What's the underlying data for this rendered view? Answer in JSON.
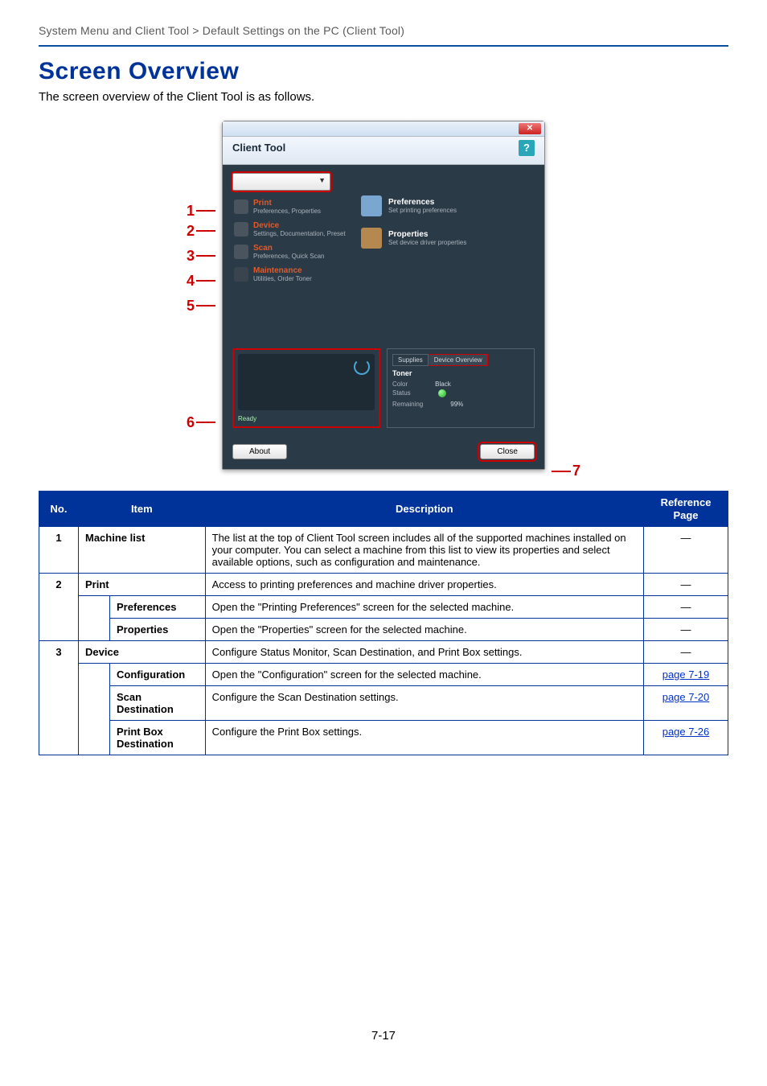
{
  "breadcrumb": "System Menu and Client Tool > Default Settings on the PC (Client Tool)",
  "title": "Screen Overview",
  "intro": "The screen overview of the Client Tool is as follows.",
  "window": {
    "header_title": "Client Tool",
    "help_glyph": "?",
    "close_glyph": "✕",
    "nav": [
      {
        "title": "Print",
        "sub": "Preferences, Properties"
      },
      {
        "title": "Device",
        "sub": "Settings, Documentation, Preset"
      },
      {
        "title": "Scan",
        "sub": "Preferences, Quick Scan"
      },
      {
        "title": "Maintenance",
        "sub": "Utilities, Order Toner"
      }
    ],
    "right_opts": [
      {
        "title": "Preferences",
        "sub": "Set printing preferences"
      },
      {
        "title": "Properties",
        "sub": "Set device driver properties"
      }
    ],
    "status_label": "Ready",
    "tabs": {
      "supplies": "Supplies",
      "device_overview": "Device Overview"
    },
    "supplies": {
      "section_label": "Toner",
      "color_label": "Color",
      "color_value": "Black",
      "status_label": "Status",
      "remaining_label": "Remaining",
      "remaining_value": "99%"
    },
    "buttons": {
      "about": "About",
      "close": "Close"
    }
  },
  "callouts": {
    "1": "1",
    "2": "2",
    "3": "3",
    "4": "4",
    "5": "5",
    "6": "6",
    "7": "7"
  },
  "table": {
    "headers": {
      "no": "No.",
      "item": "Item",
      "description": "Description",
      "ref": "Reference Page"
    },
    "dash": "—",
    "rows": {
      "1": {
        "item": "Machine list",
        "desc": "The list at the top of Client Tool screen includes all of the supported machines installed on your computer. You can select a machine from this list to view its properties and select available options, such as configuration and maintenance."
      },
      "2": {
        "item": "Print",
        "desc": "Access to printing preferences and machine driver properties."
      },
      "2a": {
        "item": "Preferences",
        "desc": "Open the \"Printing Preferences\" screen for the selected machine."
      },
      "2b": {
        "item": "Properties",
        "desc": "Open the \"Properties\" screen for the selected machine."
      },
      "3": {
        "item": "Device",
        "desc": "Configure Status Monitor, Scan Destination, and Print Box settings."
      },
      "3a": {
        "item": "Configuration",
        "desc": "Open the \"Configuration\" screen for the selected machine.",
        "ref": "page 7-19"
      },
      "3b": {
        "item": "Scan Destination",
        "desc": "Configure the Scan Destination settings.",
        "ref": "page 7-20"
      },
      "3c": {
        "item": "Print Box Destination",
        "desc": "Configure the Print Box settings.",
        "ref": "page 7-26"
      }
    }
  },
  "page_number": "7-17"
}
